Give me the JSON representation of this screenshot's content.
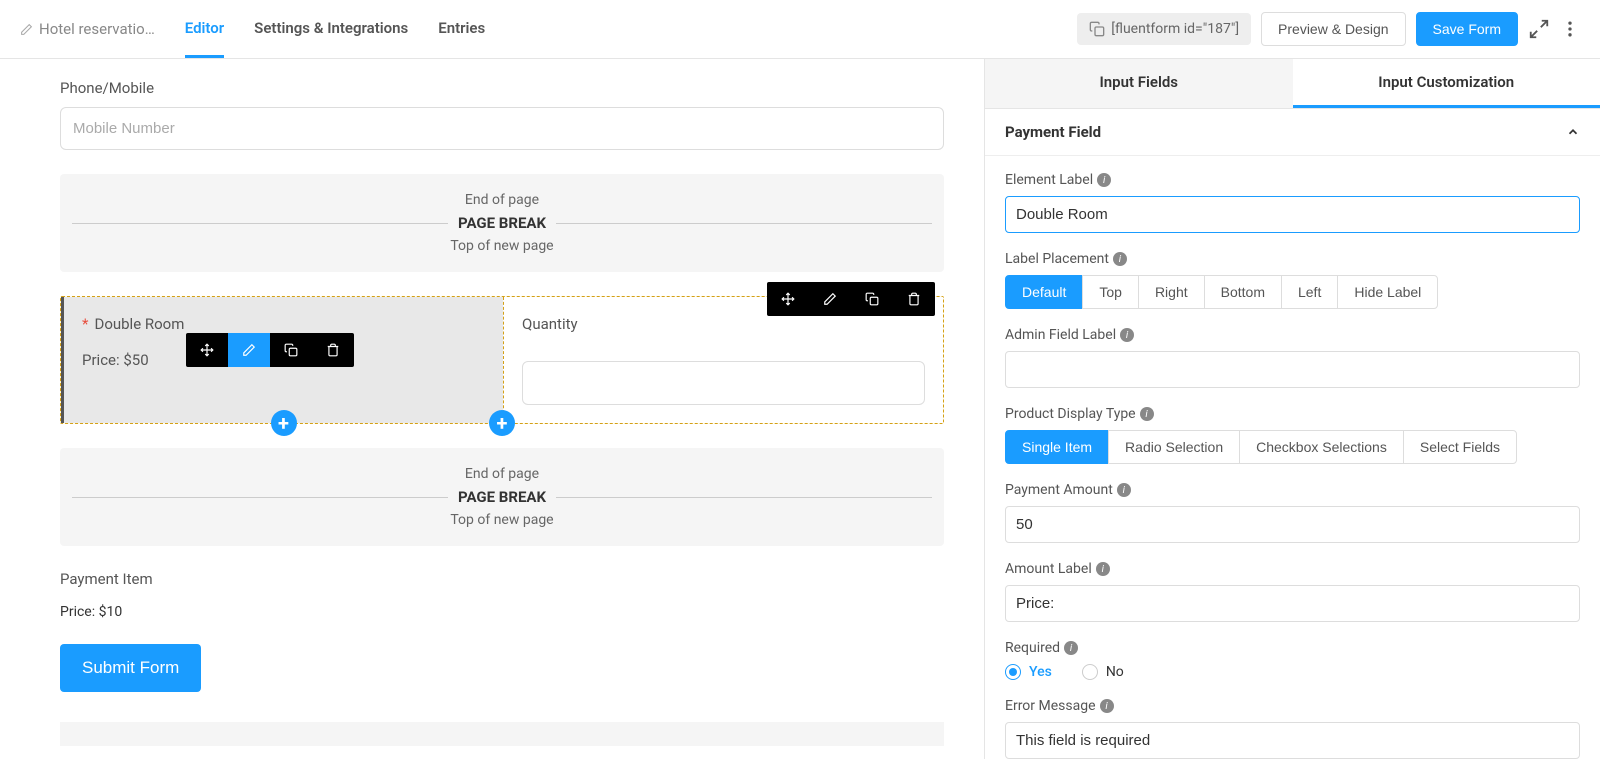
{
  "header": {
    "form_title": "Hotel reservatio…",
    "tabs": {
      "editor": "Editor",
      "settings": "Settings & Integrations",
      "entries": "Entries"
    },
    "shortcode": "[fluentform id=\"187\"]",
    "preview_btn": "Preview & Design",
    "save_btn": "Save Form"
  },
  "canvas": {
    "phone_label": "Phone/Mobile",
    "phone_placeholder": "Mobile Number",
    "page_break": {
      "top": "End of page",
      "mid": "PAGE BREAK",
      "bottom": "Top of new page"
    },
    "row": {
      "left": {
        "label": "Double Room",
        "price": "Price: $50"
      },
      "right": {
        "label": "Quantity"
      }
    },
    "payment_item": {
      "label": "Payment Item",
      "price": "Price: $10"
    },
    "submit_btn": "Submit Form"
  },
  "sidebar": {
    "tabs": {
      "fields": "Input Fields",
      "custom": "Input Customization"
    },
    "panel_title": "Payment Field",
    "element_label": {
      "label": "Element Label",
      "value": "Double Room"
    },
    "label_placement": {
      "label": "Label Placement",
      "options": [
        "Default",
        "Top",
        "Right",
        "Bottom",
        "Left",
        "Hide Label"
      ]
    },
    "admin_label": {
      "label": "Admin Field Label",
      "value": ""
    },
    "display_type": {
      "label": "Product Display Type",
      "options": [
        "Single Item",
        "Radio Selection",
        "Checkbox Selections",
        "Select Fields"
      ]
    },
    "payment_amount": {
      "label": "Payment Amount",
      "value": "50"
    },
    "amount_label": {
      "label": "Amount Label",
      "value": "Price:"
    },
    "required": {
      "label": "Required",
      "yes": "Yes",
      "no": "No"
    },
    "error_msg": {
      "label": "Error Message",
      "value": "This field is required"
    }
  }
}
